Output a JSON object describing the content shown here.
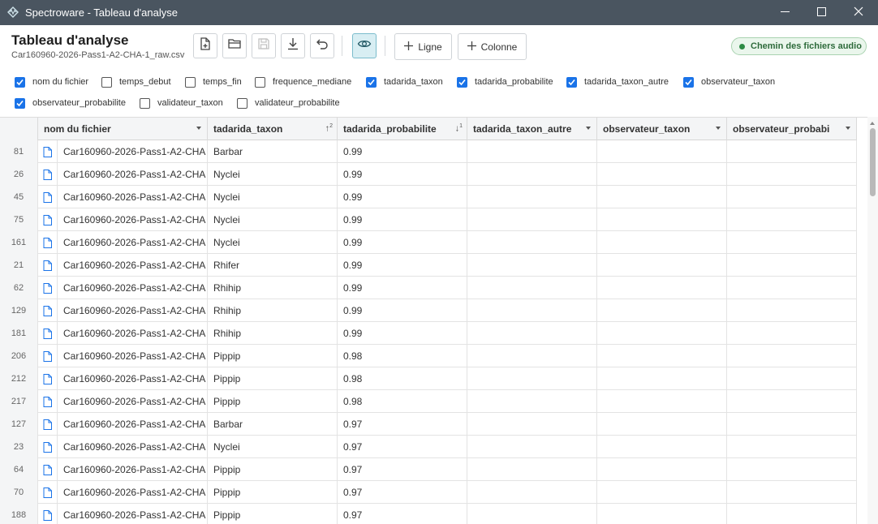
{
  "window": {
    "title": "Spectroware - Tableau d'analyse"
  },
  "header": {
    "title": "Tableau d'analyse",
    "filename": "Car160960-2026-Pass1-A2-CHA-1_raw.csv",
    "add_row_label": "Ligne",
    "add_column_label": "Colonne",
    "audio_path_label": "Chemin des fichiers audio",
    "audio_status_color": "#2e8b45"
  },
  "column_visibility": [
    {
      "label": "nom du fichier",
      "checked": true
    },
    {
      "label": "temps_debut",
      "checked": false
    },
    {
      "label": "temps_fin",
      "checked": false
    },
    {
      "label": "frequence_mediane",
      "checked": false
    },
    {
      "label": "tadarida_taxon",
      "checked": true
    },
    {
      "label": "tadarida_probabilite",
      "checked": true
    },
    {
      "label": "tadarida_taxon_autre",
      "checked": true
    },
    {
      "label": "observateur_taxon",
      "checked": true
    },
    {
      "label": "observateur_probabilite",
      "checked": true
    },
    {
      "label": "validateur_taxon",
      "checked": false
    },
    {
      "label": "validateur_probabilite",
      "checked": false
    }
  ],
  "grid": {
    "headers": {
      "nom_du_fichier": "nom du fichier",
      "tadarida_taxon": "tadarida_taxon",
      "tadarida_taxon_sort": "↑",
      "tadarida_taxon_sort_order": "2",
      "tadarida_probabilite": "tadarida_probabilite",
      "tadarida_probabilite_sort": "↓",
      "tadarida_probabilite_sort_order": "1",
      "tadarida_taxon_autre": "tadarida_taxon_autre",
      "observateur_taxon": "observateur_taxon",
      "observateur_probabilite": "observateur_probabi"
    },
    "rows": [
      {
        "n": "81",
        "file": "Car160960-2026-Pass1-A2-CHA",
        "taxon": "Barbar",
        "prob": "0.99"
      },
      {
        "n": "26",
        "file": "Car160960-2026-Pass1-A2-CHA",
        "taxon": "Nyclei",
        "prob": "0.99"
      },
      {
        "n": "45",
        "file": "Car160960-2026-Pass1-A2-CHA",
        "taxon": "Nyclei",
        "prob": "0.99"
      },
      {
        "n": "75",
        "file": "Car160960-2026-Pass1-A2-CHA",
        "taxon": "Nyclei",
        "prob": "0.99"
      },
      {
        "n": "161",
        "file": "Car160960-2026-Pass1-A2-CHA",
        "taxon": "Nyclei",
        "prob": "0.99"
      },
      {
        "n": "21",
        "file": "Car160960-2026-Pass1-A2-CHA",
        "taxon": "Rhifer",
        "prob": "0.99"
      },
      {
        "n": "62",
        "file": "Car160960-2026-Pass1-A2-CHA",
        "taxon": "Rhihip",
        "prob": "0.99"
      },
      {
        "n": "129",
        "file": "Car160960-2026-Pass1-A2-CHA",
        "taxon": "Rhihip",
        "prob": "0.99"
      },
      {
        "n": "181",
        "file": "Car160960-2026-Pass1-A2-CHA",
        "taxon": "Rhihip",
        "prob": "0.99"
      },
      {
        "n": "206",
        "file": "Car160960-2026-Pass1-A2-CHA",
        "taxon": "Pippip",
        "prob": "0.98"
      },
      {
        "n": "212",
        "file": "Car160960-2026-Pass1-A2-CHA",
        "taxon": "Pippip",
        "prob": "0.98"
      },
      {
        "n": "217",
        "file": "Car160960-2026-Pass1-A2-CHA",
        "taxon": "Pippip",
        "prob": "0.98"
      },
      {
        "n": "127",
        "file": "Car160960-2026-Pass1-A2-CHA",
        "taxon": "Barbar",
        "prob": "0.97"
      },
      {
        "n": "23",
        "file": "Car160960-2026-Pass1-A2-CHA",
        "taxon": "Nyclei",
        "prob": "0.97"
      },
      {
        "n": "64",
        "file": "Car160960-2026-Pass1-A2-CHA",
        "taxon": "Pippip",
        "prob": "0.97"
      },
      {
        "n": "70",
        "file": "Car160960-2026-Pass1-A2-CHA",
        "taxon": "Pippip",
        "prob": "0.97"
      },
      {
        "n": "188",
        "file": "Car160960-2026-Pass1-A2-CHA",
        "taxon": "Pippip",
        "prob": "0.97"
      }
    ]
  }
}
